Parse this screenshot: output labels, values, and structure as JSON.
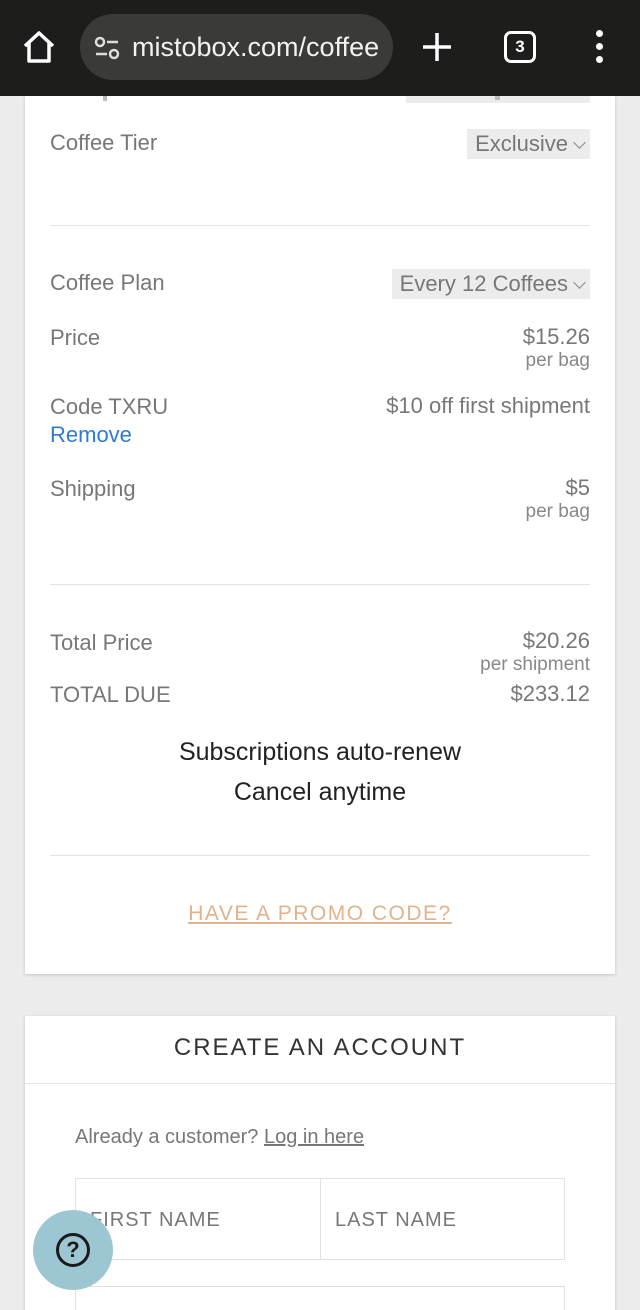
{
  "browser": {
    "url": "mistobox.com/coffee",
    "tab_count": "3",
    "icons": {
      "home": "home-icon",
      "site_settings": "tune-icon",
      "new_tab": "plus-icon",
      "tabs": "tab-switcher-icon",
      "menu": "more-vert-icon"
    }
  },
  "summary": {
    "coffee_tier": {
      "label": "Coffee Tier",
      "value": "Exclusive"
    },
    "coffee_plan": {
      "label": "Coffee Plan",
      "value": "Every 12 Coffees"
    },
    "price": {
      "label": "Price",
      "value": "$15.26",
      "unit": "per bag"
    },
    "code": {
      "label": "Code TXRU",
      "remove": "Remove",
      "value": "$10 off first shipment"
    },
    "shipping": {
      "label": "Shipping",
      "value": "$5",
      "unit": "per bag"
    },
    "total_price": {
      "label": "Total Price",
      "value": "$20.26",
      "unit": "per shipment"
    },
    "total_due": {
      "label": "TOTAL DUE",
      "value": "$233.12"
    },
    "renew_line1": "Subscriptions auto-renew",
    "renew_line2": "Cancel anytime",
    "promo_link": "HAVE A PROMO CODE?"
  },
  "account": {
    "title": "CREATE AN ACCOUNT",
    "already_text": "Already a customer?",
    "login_link": "Log in here",
    "first_name_placeholder": "FIRST NAME",
    "last_name_placeholder": "LAST NAME"
  },
  "help": {
    "icon": "help-icon",
    "symbol": "?"
  },
  "colors": {
    "accent_link": "#2f7bd1",
    "promo": "#e0b38c",
    "help_fab": "#9dc6d3",
    "browser_bar": "#1d1d1b"
  }
}
